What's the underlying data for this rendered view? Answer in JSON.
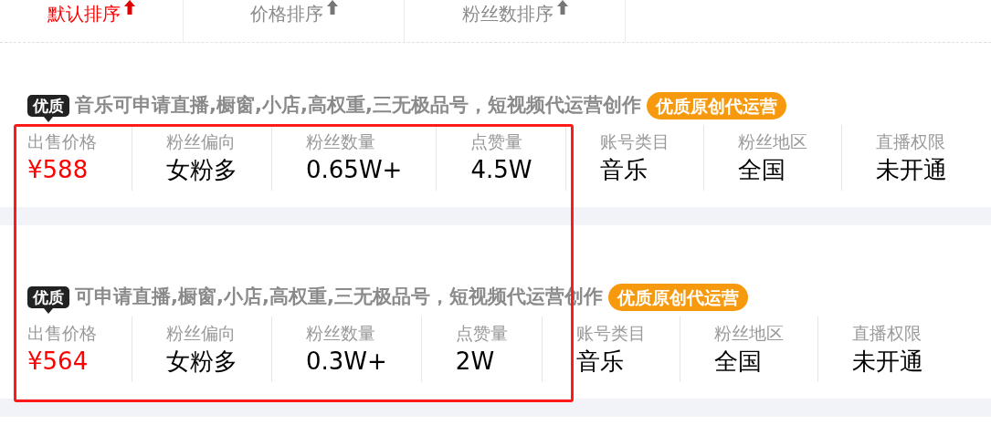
{
  "sort_tabs": [
    {
      "label": "默认排序",
      "selected": true
    },
    {
      "label": "价格排序",
      "selected": false
    },
    {
      "label": "粉丝数排序",
      "selected": false
    }
  ],
  "listings": [
    {
      "badge": "优质",
      "title": "音乐可申请直播,橱窗,小店,高权重,三无极品号，短视频代运营创作",
      "tag": "优质原创代运营",
      "stats": [
        {
          "label": "出售价格",
          "value": "¥588",
          "kind": "price"
        },
        {
          "label": "粉丝偏向",
          "value": "女粉多",
          "kind": "plain"
        },
        {
          "label": "粉丝数量",
          "value": "0.65W+",
          "kind": "plain"
        },
        {
          "label": "点赞量",
          "value": "4.5W",
          "kind": "plain"
        },
        {
          "label": "账号类目",
          "value": "音乐",
          "kind": "plain"
        },
        {
          "label": "粉丝地区",
          "value": "全国",
          "kind": "plain"
        },
        {
          "label": "直播权限",
          "value": "未开通",
          "kind": "plain"
        }
      ]
    },
    {
      "badge": "优质",
      "title": "可申请直播,橱窗,小店,高权重,三无极品号，短视频代运营创作",
      "tag": "优质原创代运营",
      "stats": [
        {
          "label": "出售价格",
          "value": "¥564",
          "kind": "price"
        },
        {
          "label": "粉丝偏向",
          "value": "女粉多",
          "kind": "plain"
        },
        {
          "label": "粉丝数量",
          "value": "0.3W+",
          "kind": "plain"
        },
        {
          "label": "点赞量",
          "value": "2W",
          "kind": "plain"
        },
        {
          "label": "账号类目",
          "value": "音乐",
          "kind": "plain"
        },
        {
          "label": "粉丝地区",
          "value": "全国",
          "kind": "plain"
        },
        {
          "label": "直播权限",
          "value": "未开通",
          "kind": "plain"
        }
      ]
    }
  ]
}
